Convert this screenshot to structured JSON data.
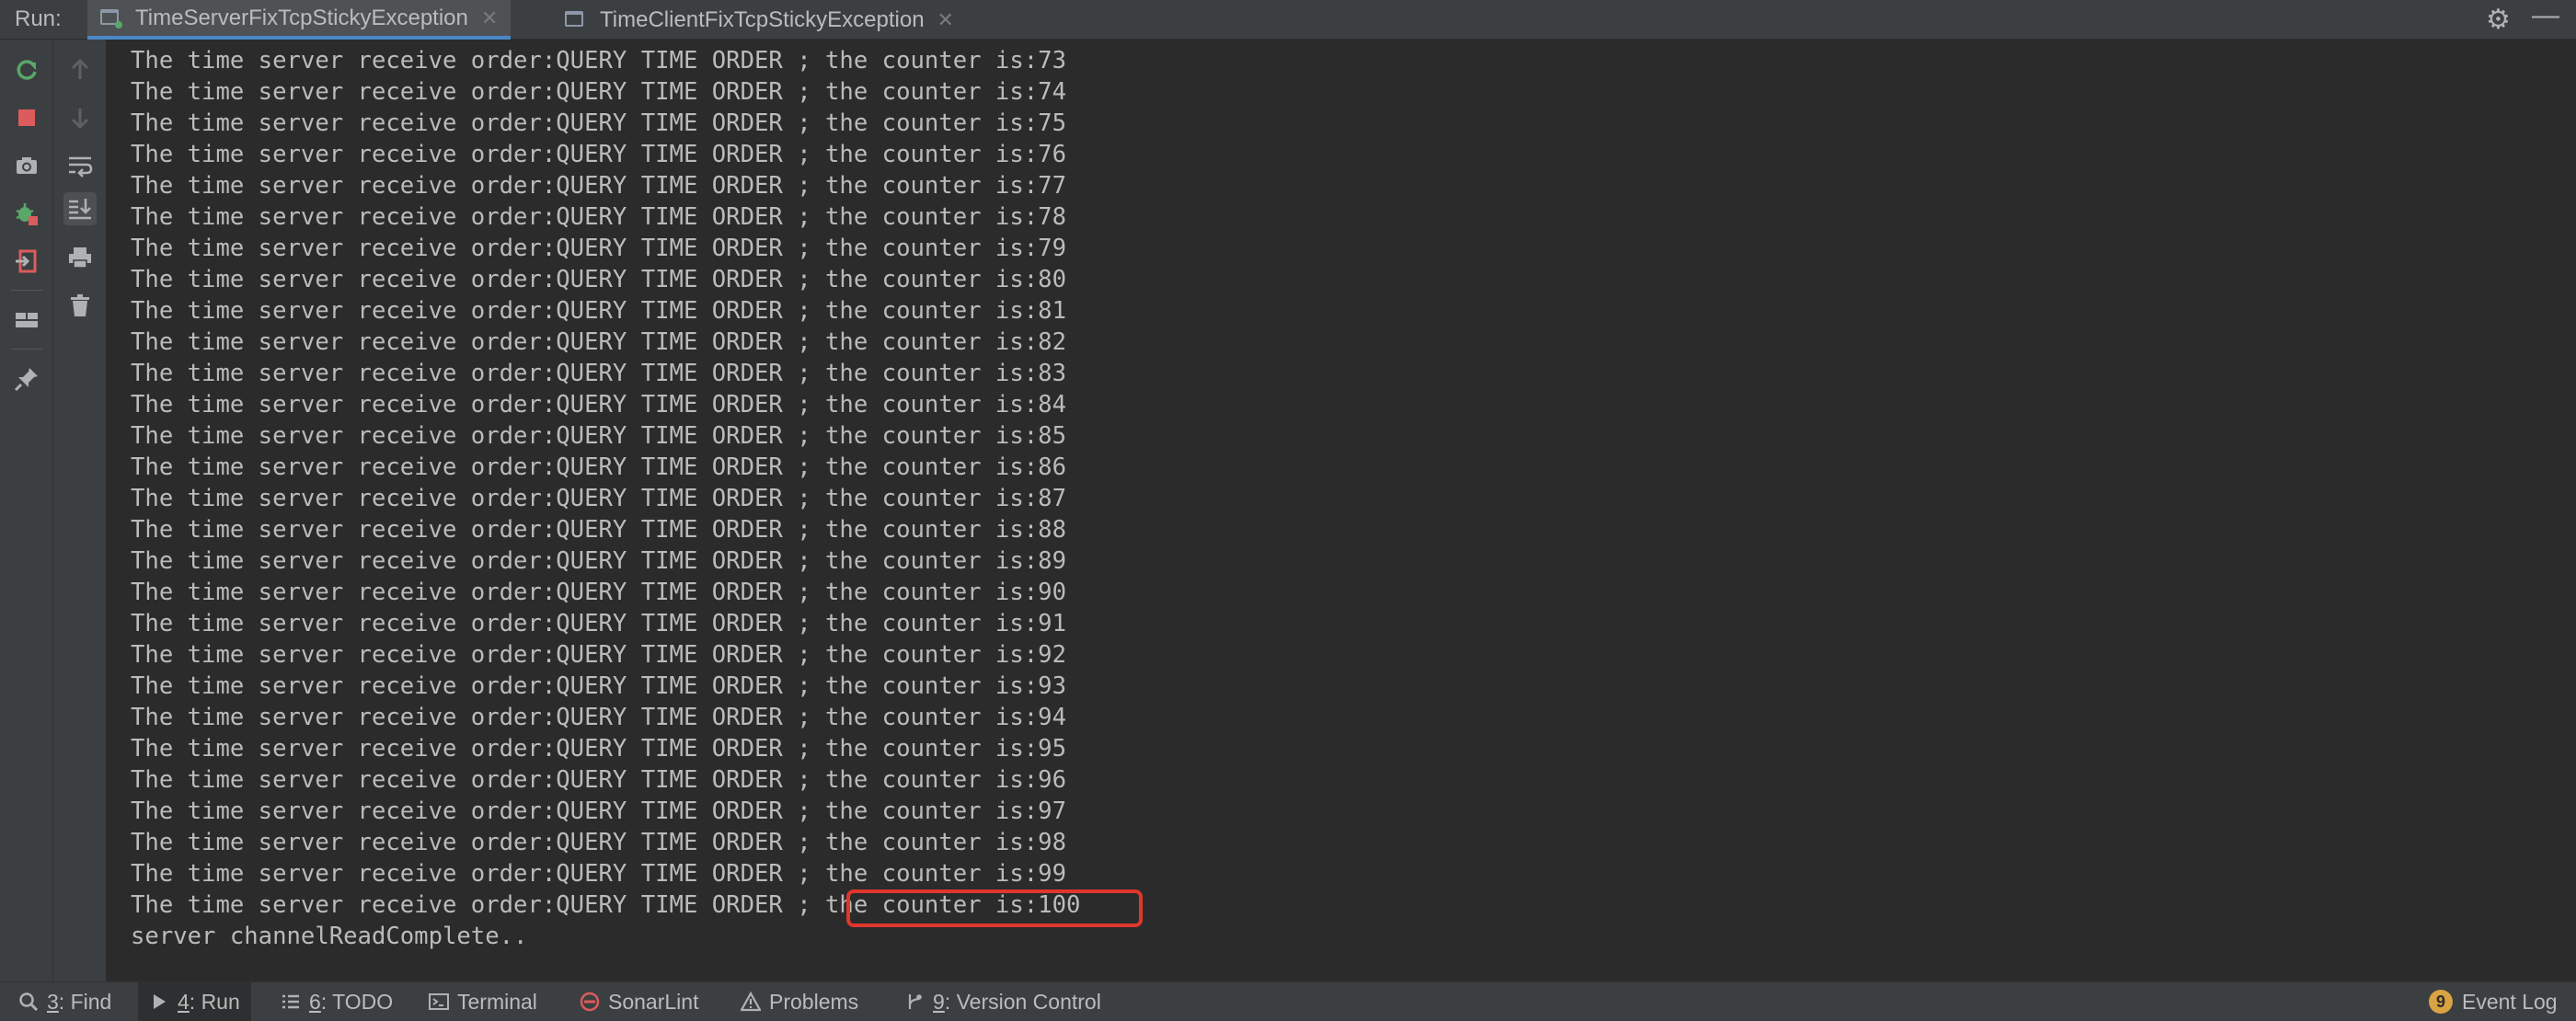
{
  "run_bar": {
    "label": "Run:",
    "tabs": [
      {
        "title": "TimeServerFixTcpStickyException",
        "active": true
      },
      {
        "title": "TimeClientFixTcpStickyException",
        "active": false
      }
    ],
    "right_icons": [
      "gear-icon",
      "minimize-icon"
    ]
  },
  "console": {
    "lines": [
      "The time server receive order:QUERY TIME ORDER ; the counter is:73",
      "The time server receive order:QUERY TIME ORDER ; the counter is:74",
      "The time server receive order:QUERY TIME ORDER ; the counter is:75",
      "The time server receive order:QUERY TIME ORDER ; the counter is:76",
      "The time server receive order:QUERY TIME ORDER ; the counter is:77",
      "The time server receive order:QUERY TIME ORDER ; the counter is:78",
      "The time server receive order:QUERY TIME ORDER ; the counter is:79",
      "The time server receive order:QUERY TIME ORDER ; the counter is:80",
      "The time server receive order:QUERY TIME ORDER ; the counter is:81",
      "The time server receive order:QUERY TIME ORDER ; the counter is:82",
      "The time server receive order:QUERY TIME ORDER ; the counter is:83",
      "The time server receive order:QUERY TIME ORDER ; the counter is:84",
      "The time server receive order:QUERY TIME ORDER ; the counter is:85",
      "The time server receive order:QUERY TIME ORDER ; the counter is:86",
      "The time server receive order:QUERY TIME ORDER ; the counter is:87",
      "The time server receive order:QUERY TIME ORDER ; the counter is:88",
      "The time server receive order:QUERY TIME ORDER ; the counter is:89",
      "The time server receive order:QUERY TIME ORDER ; the counter is:90",
      "The time server receive order:QUERY TIME ORDER ; the counter is:91",
      "The time server receive order:QUERY TIME ORDER ; the counter is:92",
      "The time server receive order:QUERY TIME ORDER ; the counter is:93",
      "The time server receive order:QUERY TIME ORDER ; the counter is:94",
      "The time server receive order:QUERY TIME ORDER ; the counter is:95",
      "The time server receive order:QUERY TIME ORDER ; the counter is:96",
      "The time server receive order:QUERY TIME ORDER ; the counter is:97",
      "The time server receive order:QUERY TIME ORDER ; the counter is:98",
      "The time server receive order:QUERY TIME ORDER ; the counter is:99",
      "The time server receive order:QUERY TIME ORDER ; the counter is:100",
      "server channelReadComplete.."
    ]
  },
  "left_toolbar": [
    "rerun-icon",
    "stop-icon",
    "camera-icon",
    "debug-icon",
    "exit-icon",
    "layout-icon",
    "pin-icon"
  ],
  "left_toolbar_2": [
    "up-arrow-icon",
    "down-arrow-icon",
    "soft-wrap-icon",
    "scroll-to-end-icon",
    "print-icon",
    "trash-icon"
  ],
  "bottom_bar": {
    "find": {
      "num": "3",
      "label": ": Find"
    },
    "run": {
      "num": "4",
      "label": ": Run"
    },
    "todo": {
      "num": "6",
      "label": ": TODO"
    },
    "terminal": "Terminal",
    "sonarlint": "SonarLint",
    "problems": "Problems",
    "vcs": {
      "num": "9",
      "label": ": Version Control"
    },
    "event_log": {
      "count": "9",
      "label": "Event Log"
    }
  },
  "colors": {
    "console_bg": "#2b2b2b",
    "panel_bg": "#3c3f41",
    "text": "#bbbbbb",
    "highlight": "#e0362c",
    "accent": "#4a88c7"
  }
}
